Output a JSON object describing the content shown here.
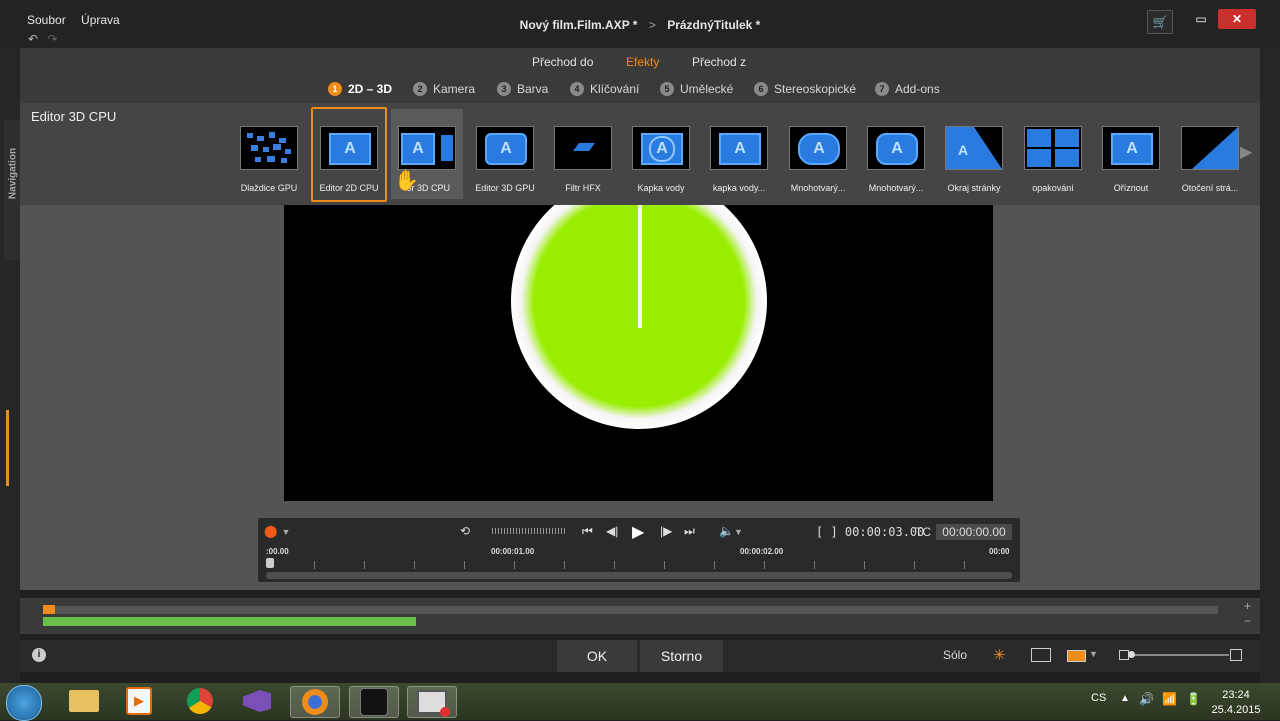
{
  "menu": {
    "file": "Soubor",
    "edit": "Úprava"
  },
  "title": {
    "project": "Nový film.Film.AXP *",
    "item": "PrázdnýTitulek *"
  },
  "top_tabs": [
    {
      "label": "Přechod do",
      "active": false
    },
    {
      "label": "Efekty",
      "active": true
    },
    {
      "label": "Přechod z",
      "active": false
    }
  ],
  "sub_tabs": [
    {
      "num": "1",
      "label": "2D – 3D"
    },
    {
      "num": "2",
      "label": "Kamera"
    },
    {
      "num": "3",
      "label": "Barva"
    },
    {
      "num": "4",
      "label": "Klíčování"
    },
    {
      "num": "5",
      "label": "Umělecké"
    },
    {
      "num": "6",
      "label": "Stereoskopické"
    },
    {
      "num": "7",
      "label": "Add-ons"
    }
  ],
  "editor_title": "Editor 3D CPU",
  "navigation_label": "Navigation",
  "effects": [
    {
      "label": "Dlaždice GPU",
      "icon": "tiles-icon"
    },
    {
      "label": "Editor 2D CPU",
      "icon": "editor-2d-icon",
      "selected": true
    },
    {
      "label": "tor 3D CPU",
      "icon": "editor-3d-cpu-icon",
      "hovered": true
    },
    {
      "label": "Editor 3D GPU",
      "icon": "editor-3d-gpu-icon"
    },
    {
      "label": "Filtr HFX",
      "icon": "hfx-icon"
    },
    {
      "label": "Kapka vody",
      "icon": "water-drop-icon"
    },
    {
      "label": "kapka vody...",
      "icon": "water-drop2-icon"
    },
    {
      "label": "Mnohotvarý...",
      "icon": "polygon-icon"
    },
    {
      "label": "Mnohotvarý...",
      "icon": "polygon2-icon"
    },
    {
      "label": "Okraj stránky",
      "icon": "page-edge-icon"
    },
    {
      "label": "opakování",
      "icon": "repeat-icon"
    },
    {
      "label": "Oříznout",
      "icon": "crop-icon"
    },
    {
      "label": "Otočení strá...",
      "icon": "page-turn-icon"
    }
  ],
  "transport": {
    "in_time": ":00.00",
    "mark1": "00:00:01.00",
    "mark2": "00:00:02.00",
    "end_time": "00:00",
    "duration": "[ ] 00:00:03.00",
    "tc_label": "TC",
    "tc_value": "00:00:00.00"
  },
  "footer": {
    "ok": "OK",
    "cancel": "Storno",
    "solo": "Sólo"
  },
  "taskbar": {
    "lang": "CS",
    "time": "23:24",
    "date": "25.4.2015"
  },
  "colors": {
    "accent": "#f08c1a",
    "preview_circle": "#99ee00",
    "timeline_green": "#6abf4b"
  }
}
